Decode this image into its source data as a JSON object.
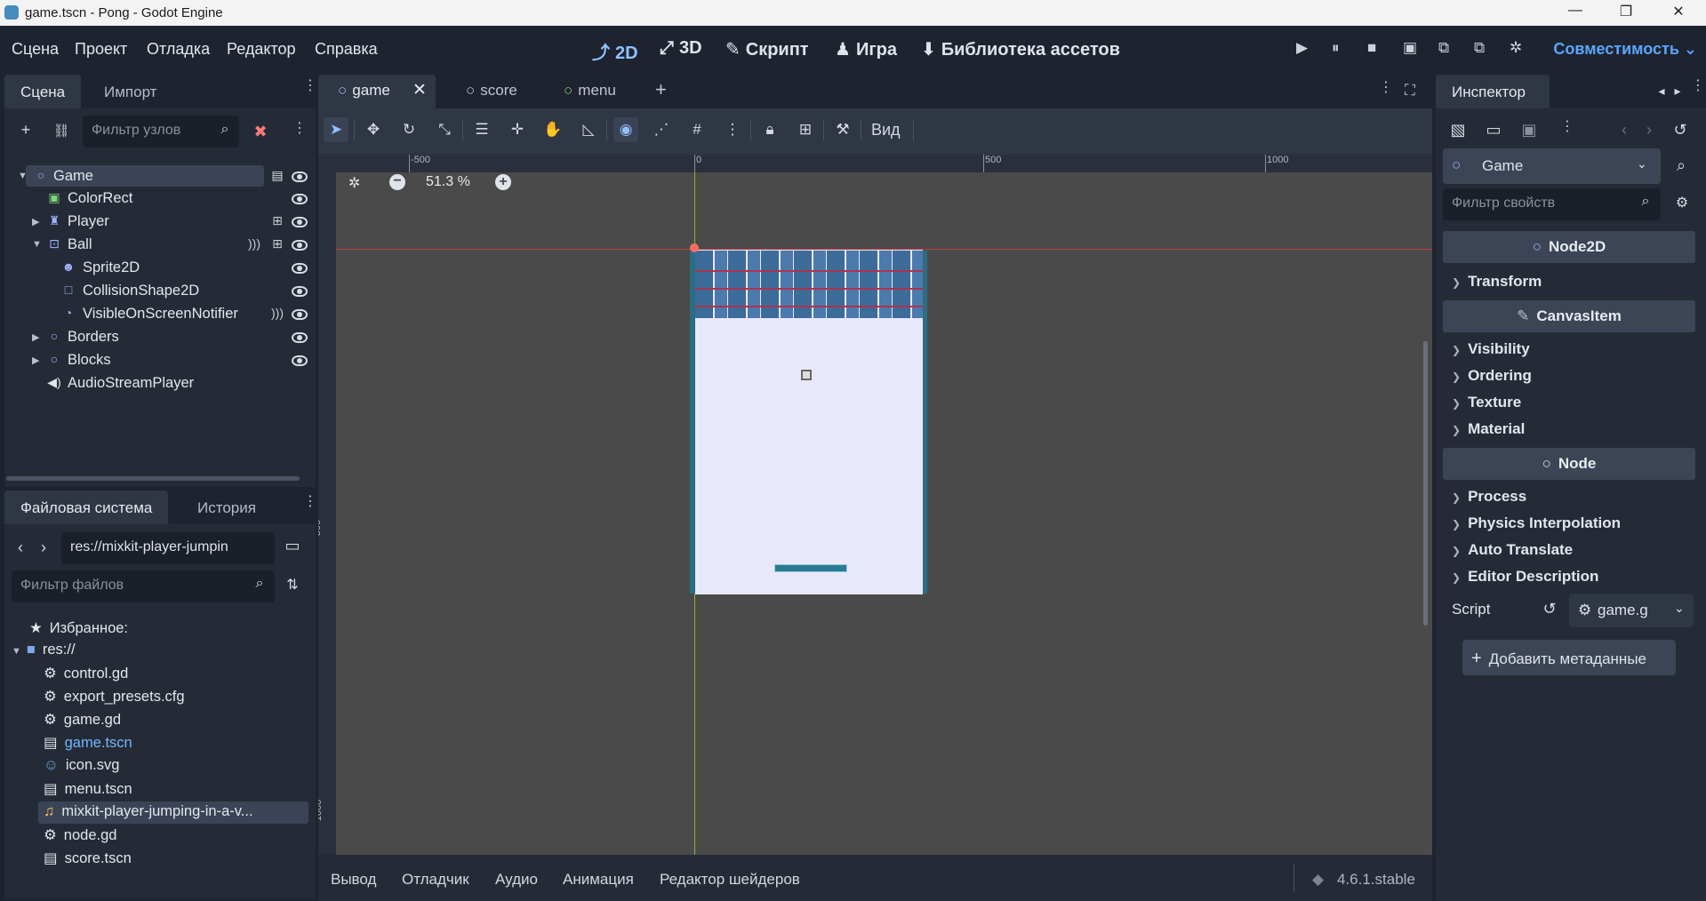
{
  "window": {
    "title": "game.tscn - Pong - Godot Engine",
    "minimize": "—",
    "restore": "❐",
    "close": "✕"
  },
  "menu": [
    "Сцена",
    "Проект",
    "Отладка",
    "Редактор",
    "Справка"
  ],
  "workspaces": [
    {
      "icon": "⤴",
      "label": "2D"
    },
    {
      "icon": "⤢",
      "label": "3D"
    },
    {
      "icon": "✎",
      "label": "Скрипт"
    },
    {
      "icon": "♟",
      "label": "Игра"
    },
    {
      "icon": "⬇",
      "label": "Библиотека ассетов"
    }
  ],
  "playbar": [
    "▶",
    "⏸",
    "■",
    "▣",
    "⧉",
    "⧉",
    "✲"
  ],
  "compat": "Совместимость ⌄",
  "scene_dock": {
    "tabs": [
      "Сцена",
      "Импорт"
    ],
    "filter_placeholder": "Фильтр узлов",
    "nodes": [
      "Game",
      "ColorRect",
      "Player",
      "Ball",
      "Sprite2D",
      "CollisionShape2D",
      "VisibleOnScreenNotifier",
      "Borders",
      "Blocks",
      "AudioStreamPlayer"
    ]
  },
  "fs_dock": {
    "tabs": [
      "Файловая система",
      "История"
    ],
    "path": "res://mixkit-player-jumpin",
    "filter_placeholder": "Фильтр файлов",
    "favorites": "Избранное:",
    "root": "res://",
    "files": [
      "control.gd",
      "export_presets.cfg",
      "game.gd",
      "game.tscn",
      "icon.svg",
      "menu.tscn",
      "mixkit-player-jumping-in-a-v...",
      "node.gd",
      "score.tscn"
    ]
  },
  "scene_tabs": [
    "game",
    "score",
    "menu"
  ],
  "viewport": {
    "zoom": "51.3 %",
    "view_menu": "Вид",
    "ruler_h": [
      "-500",
      "0",
      "500",
      "1000"
    ],
    "ruler_v": [
      "0",
      "500",
      "1000"
    ]
  },
  "inspector": {
    "tab": "Инспектор",
    "node": "Game",
    "filter_placeholder": "Фильтр свойств",
    "sections": [
      {
        "header": "Node2D",
        "items": [
          "Transform"
        ]
      },
      {
        "header": "CanvasItem",
        "items": [
          "Visibility",
          "Ordering",
          "Texture",
          "Material"
        ]
      },
      {
        "header": "Node",
        "items": [
          "Process",
          "Physics Interpolation",
          "Auto Translate",
          "Editor Description"
        ]
      }
    ],
    "script_label": "Script",
    "script_value": "game.g",
    "add_meta": "Добавить метаданные"
  },
  "bottom": {
    "tabs": [
      "Вывод",
      "Отладчик",
      "Аудио",
      "Анимация",
      "Редактор шейдеров"
    ],
    "version": "4.6.1.stable"
  }
}
